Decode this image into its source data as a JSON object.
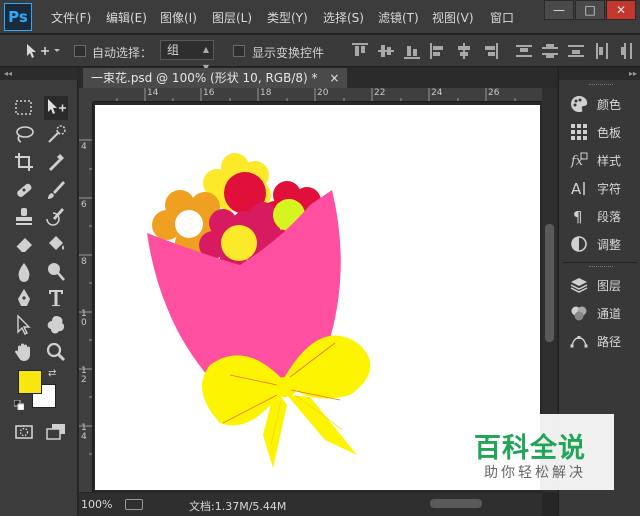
{
  "app": {
    "logo": "Ps"
  },
  "menu": [
    "文件(F)",
    "编辑(E)",
    "图像(I)",
    "图层(L)",
    "类型(Y)",
    "选择(S)",
    "滤镜(T)",
    "视图(V)",
    "窗口"
  ],
  "window_controls": {
    "minimize": "—",
    "maximize": "□",
    "close": "✕"
  },
  "options": {
    "auto_select_label": "自动选择：",
    "auto_select_value": "组",
    "transform_controls_label": "显示变换控件"
  },
  "document": {
    "tab_title": "一束花.psd @ 100% (形状 10, RGB/8) *",
    "tab_close": "×"
  },
  "rulers": {
    "top": [
      "14",
      "16",
      "18",
      "20",
      "22",
      "24",
      "26"
    ],
    "left": [
      "4",
      "6",
      "8",
      "1\n0",
      "1\n2",
      "1\n4"
    ]
  },
  "status": {
    "zoom": "100%",
    "doc_size": "文档:1.37M/5.44M"
  },
  "colors": {
    "foreground": "#f7e70e",
    "background": "#ffffff"
  },
  "panels": {
    "group1": [
      {
        "label": "颜色",
        "icon": "palette-icon"
      },
      {
        "label": "色板",
        "icon": "swatches-icon"
      },
      {
        "label": "样式",
        "icon": "styles-icon"
      },
      {
        "label": "字符",
        "icon": "character-icon"
      },
      {
        "label": "段落",
        "icon": "paragraph-icon"
      },
      {
        "label": "调整",
        "icon": "adjustments-icon"
      }
    ],
    "group2": [
      {
        "label": "图层",
        "icon": "layers-icon"
      },
      {
        "label": "通道",
        "icon": "channels-icon"
      },
      {
        "label": "路径",
        "icon": "paths-icon"
      }
    ]
  },
  "watermark": {
    "main": "百科全说",
    "sub": "助你轻松解决"
  }
}
